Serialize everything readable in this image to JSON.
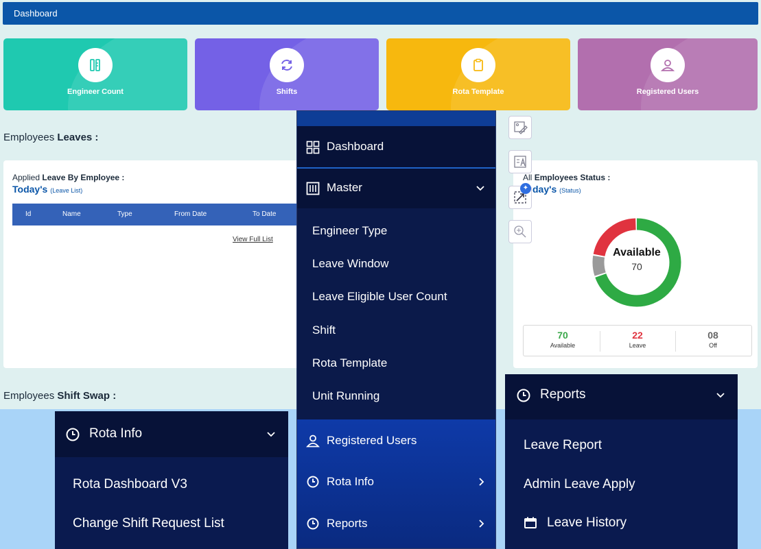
{
  "header": {
    "title": "Dashboard"
  },
  "cards": [
    {
      "label": "Engineer Count",
      "color": "#1fc9b0"
    },
    {
      "label": "Shifts",
      "color": "#7461e6"
    },
    {
      "label": "Rota Template",
      "color": "#f7b80e"
    },
    {
      "label": "Registered Users",
      "color": "#b26fae"
    }
  ],
  "leaves_section": {
    "prefix": "Employees",
    "bold": "Leaves :"
  },
  "leave_panel": {
    "line1_prefix": "Applied",
    "line1_bold": "Leave By Employee :",
    "line2": "Today's",
    "line2_small": "(Leave List)",
    "columns": [
      "Id",
      "Name",
      "Type",
      "From Date",
      "To Date"
    ],
    "view_full": "View Full List"
  },
  "status_panel": {
    "line1_prefix": "All",
    "line1_bold": "Employees Status :",
    "line2": "day's",
    "line2_small": "(Status)",
    "donut_title": "Available",
    "donut_value": "70",
    "stats": [
      {
        "value": "70",
        "label": "Available",
        "color": "#3aa84a"
      },
      {
        "value": "22",
        "label": "Leave",
        "color": "#e0333f"
      },
      {
        "value": "08",
        "label": "Off",
        "color": "#666666"
      }
    ],
    "donut_fractions": {
      "available": 0.7,
      "leave": 0.22,
      "off": 0.08
    },
    "donut_colors": {
      "available": "#2eaa44",
      "leave": "#e0333f",
      "off": "#9a9a9a"
    }
  },
  "shift_swap_section": {
    "prefix": "Employees",
    "bold": "Shift Swap :"
  },
  "center_menu": {
    "dashboard": "Dashboard",
    "master": "Master",
    "master_items": [
      "Engineer Type",
      "Leave Window",
      "Leave Eligible User Count",
      "Shift",
      "Rota Template",
      "Unit Running"
    ],
    "registered_users": "Registered Users",
    "rota_info": "Rota Info",
    "reports": "Reports"
  },
  "rota_menu": {
    "title": "Rota Info",
    "items": [
      "Rota Dashboard V3",
      "Change Shift Request List"
    ]
  },
  "reports_menu": {
    "title": "Reports",
    "items": [
      "Leave Report",
      "Admin Leave Apply",
      "Leave History"
    ]
  },
  "icons": {
    "card_icons": [
      "ruler-pencil-icon",
      "refresh-icon",
      "clipboard-icon",
      "user-icon"
    ],
    "tools": [
      "edit-image-icon",
      "text-image-icon",
      "resize-image-icon",
      "zoom-icon"
    ]
  }
}
